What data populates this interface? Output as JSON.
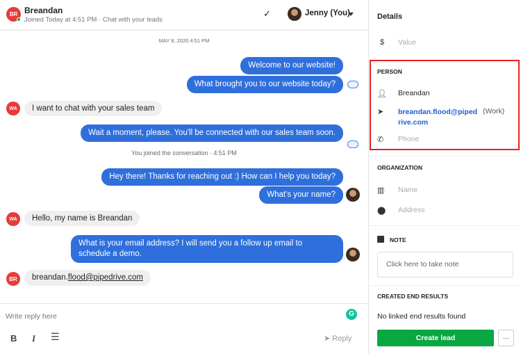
{
  "header": {
    "avatar_initials": "BR",
    "name": "Breandan",
    "subtitle": "Joined Today at 4:51 PM",
    "channel": "· Chat with your leads",
    "agent": "Jenny (You)"
  },
  "chat": {
    "date": "MAY 8, 2020 4:51 PM",
    "system": "You joined the conversation · 4:51 PM",
    "messages": [
      {
        "dir": "out",
        "text": "Welcome to our website!"
      },
      {
        "dir": "out",
        "text": "What brought you to our website today?"
      },
      {
        "dir": "in",
        "avatar": "WA",
        "text": "I want to chat with your sales team"
      },
      {
        "dir": "out",
        "text": "Wait a moment, please. You'll be connected with our sales team soon."
      },
      {
        "dir": "out",
        "text": "Hey there! Thanks for reaching out :) How can I help you today?"
      },
      {
        "dir": "out",
        "text": "What's your name?"
      },
      {
        "dir": "in",
        "avatar": "WA",
        "text": "Hello, my name is Breandan"
      },
      {
        "dir": "out",
        "text": "What is your email address? I will send you a follow up email to schedule a demo."
      },
      {
        "dir": "in",
        "avatar": "BR",
        "text_prefix": "breandan.",
        "text_link": "flood@pipedrive.com"
      }
    ]
  },
  "composer": {
    "placeholder": "Write reply here",
    "reply": "Reply",
    "bold": "B",
    "italic": "I"
  },
  "details": {
    "title": "Details",
    "value_placeholder": "Value",
    "currency_icon": "$",
    "person": {
      "heading": "PERSON",
      "name": "Breandan",
      "email": "breandan.flood@pipedrive.com",
      "email_type": "(Work)",
      "phone_placeholder": "Phone"
    },
    "organization": {
      "heading": "ORGANIZATION",
      "name_placeholder": "Name",
      "address_placeholder": "Address"
    },
    "note": {
      "heading": "NOTE",
      "placeholder": "Click here to take note"
    },
    "end_results": {
      "heading": "CREATED END RESULTS",
      "empty": "No linked end results found"
    },
    "create_lead": "Create lead",
    "more": "···"
  },
  "colors": {
    "accent": "#2f6fdb",
    "green": "#08a742",
    "highlight": "#e82020"
  }
}
